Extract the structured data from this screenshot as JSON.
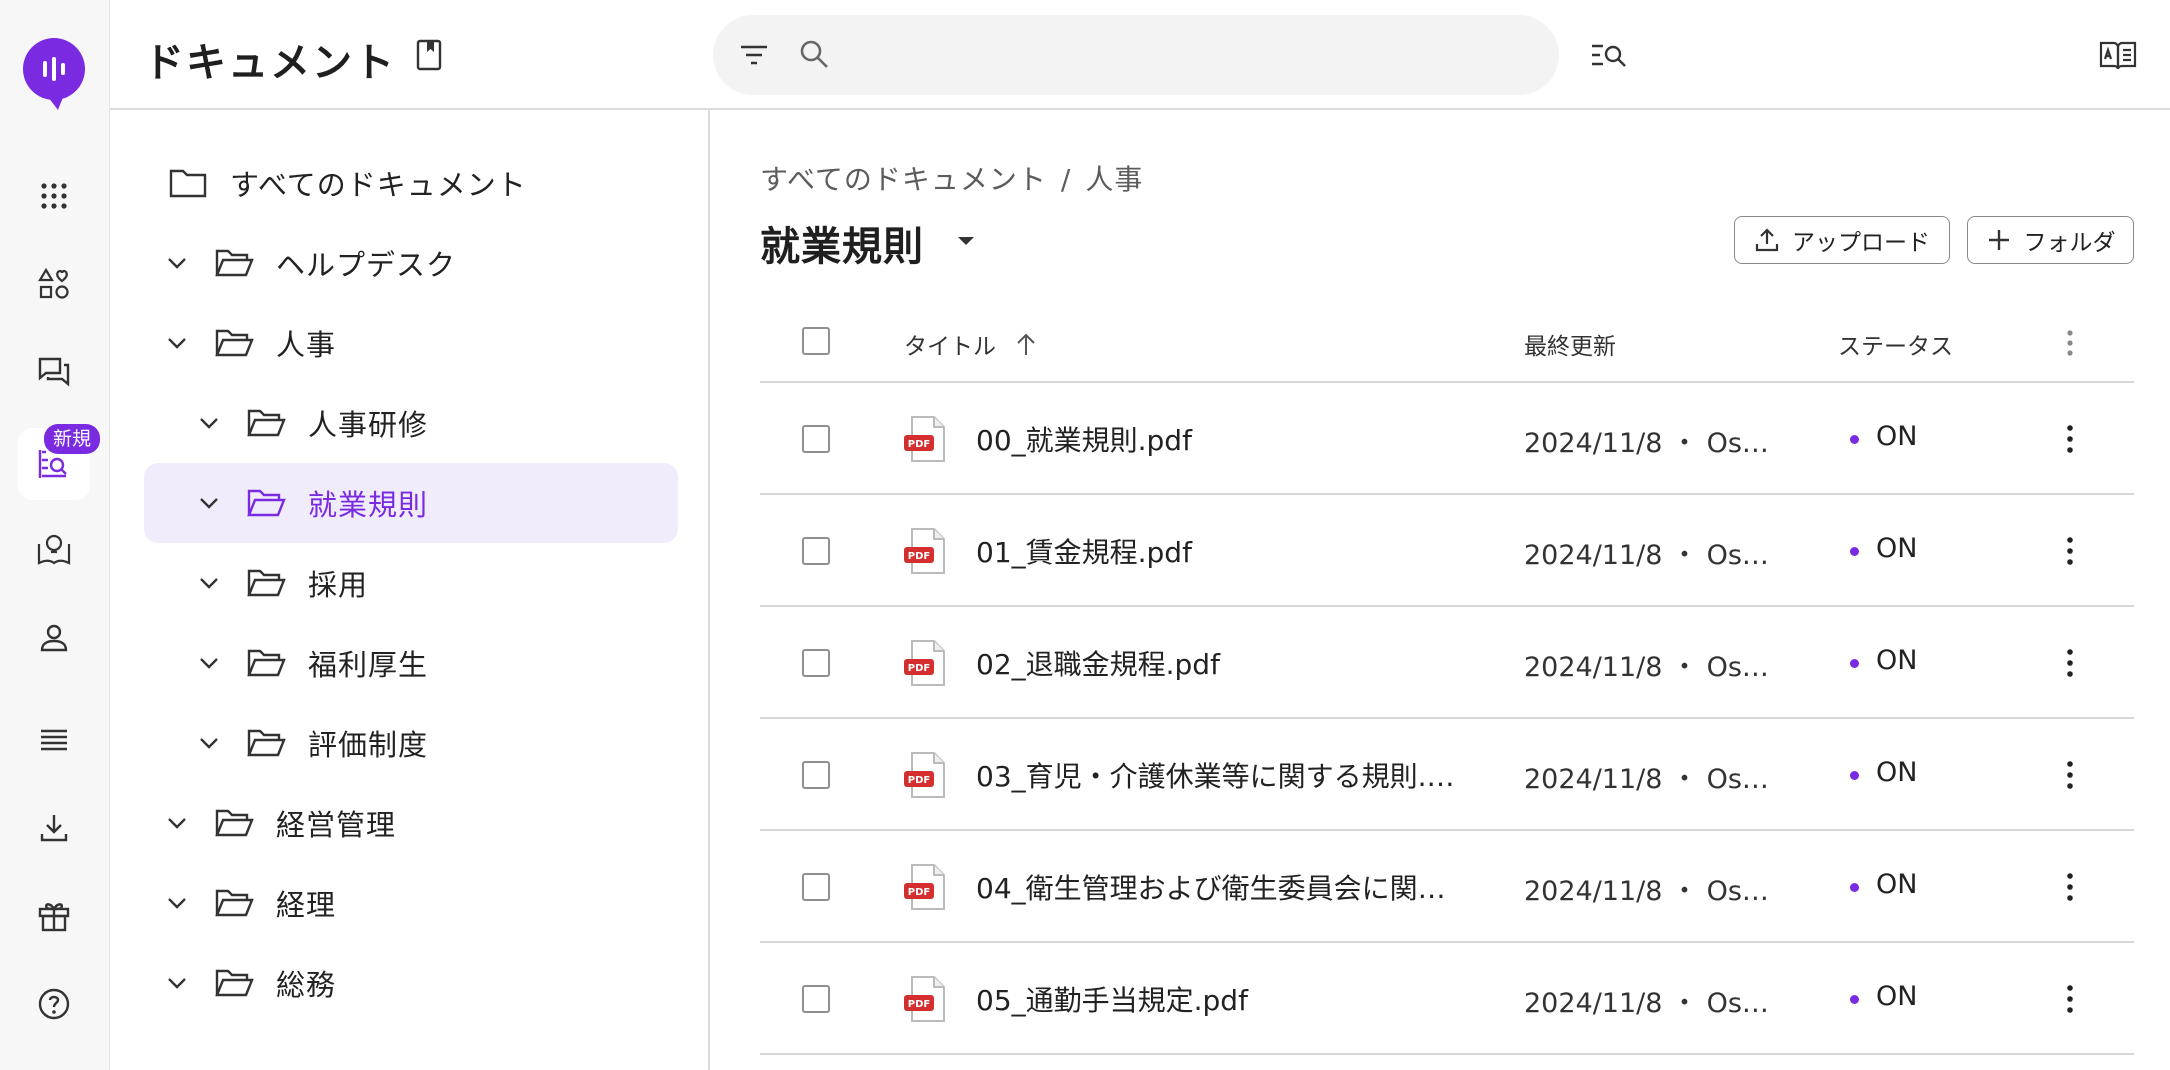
{
  "colors": {
    "accent": "#7a2be2",
    "selected_bg": "#f1ecfc",
    "rail_bg": "#f7f7f7",
    "search_bg": "#f3f3f3"
  },
  "rail": {
    "badge": "新規",
    "icons": [
      "app-grid-icon",
      "shapes-heart-icon",
      "chat-icon",
      "document-search-icon",
      "knowledge-icon",
      "user-icon",
      "list-icon",
      "download-icon",
      "gift-icon",
      "help-icon"
    ]
  },
  "header": {
    "title": "ドキュメント",
    "search_placeholder": ""
  },
  "tree": {
    "root": "すべてのドキュメント",
    "items": [
      {
        "label": "ヘルプデスク",
        "level": 1
      },
      {
        "label": "人事",
        "level": 1
      },
      {
        "label": "人事研修",
        "level": 2
      },
      {
        "label": "就業規則",
        "level": 2,
        "selected": true
      },
      {
        "label": "採用",
        "level": 2
      },
      {
        "label": "福利厚生",
        "level": 2
      },
      {
        "label": "評価制度",
        "level": 2
      },
      {
        "label": "経営管理",
        "level": 1
      },
      {
        "label": "経理",
        "level": 1
      },
      {
        "label": "総務",
        "level": 1
      }
    ]
  },
  "main": {
    "breadcrumb": [
      "すべてのドキュメント",
      "人事"
    ],
    "breadcrumb_sep": "/",
    "folder_title": "就業規則",
    "upload_label": "アップロード",
    "new_folder_label": "フォルダ",
    "columns": {
      "title": "タイトル",
      "updated": "最終更新",
      "status": "ステータス"
    },
    "rows": [
      {
        "name": "00_就業規則.pdf",
        "updated": "2024/11/8 ・ Os…",
        "status": "ON"
      },
      {
        "name": "01_賃金規程.pdf",
        "updated": "2024/11/8 ・ Os…",
        "status": "ON"
      },
      {
        "name": "02_退職金規程.pdf",
        "updated": "2024/11/8 ・ Os…",
        "status": "ON"
      },
      {
        "name": "03_育児・介護休業等に関する規則.…",
        "updated": "2024/11/8 ・ Os…",
        "status": "ON"
      },
      {
        "name": "04_衛生管理および衛生委員会に関…",
        "updated": "2024/11/8 ・ Os…",
        "status": "ON"
      },
      {
        "name": "05_通勤手当規定.pdf",
        "updated": "2024/11/8 ・ Os…",
        "status": "ON"
      }
    ]
  }
}
